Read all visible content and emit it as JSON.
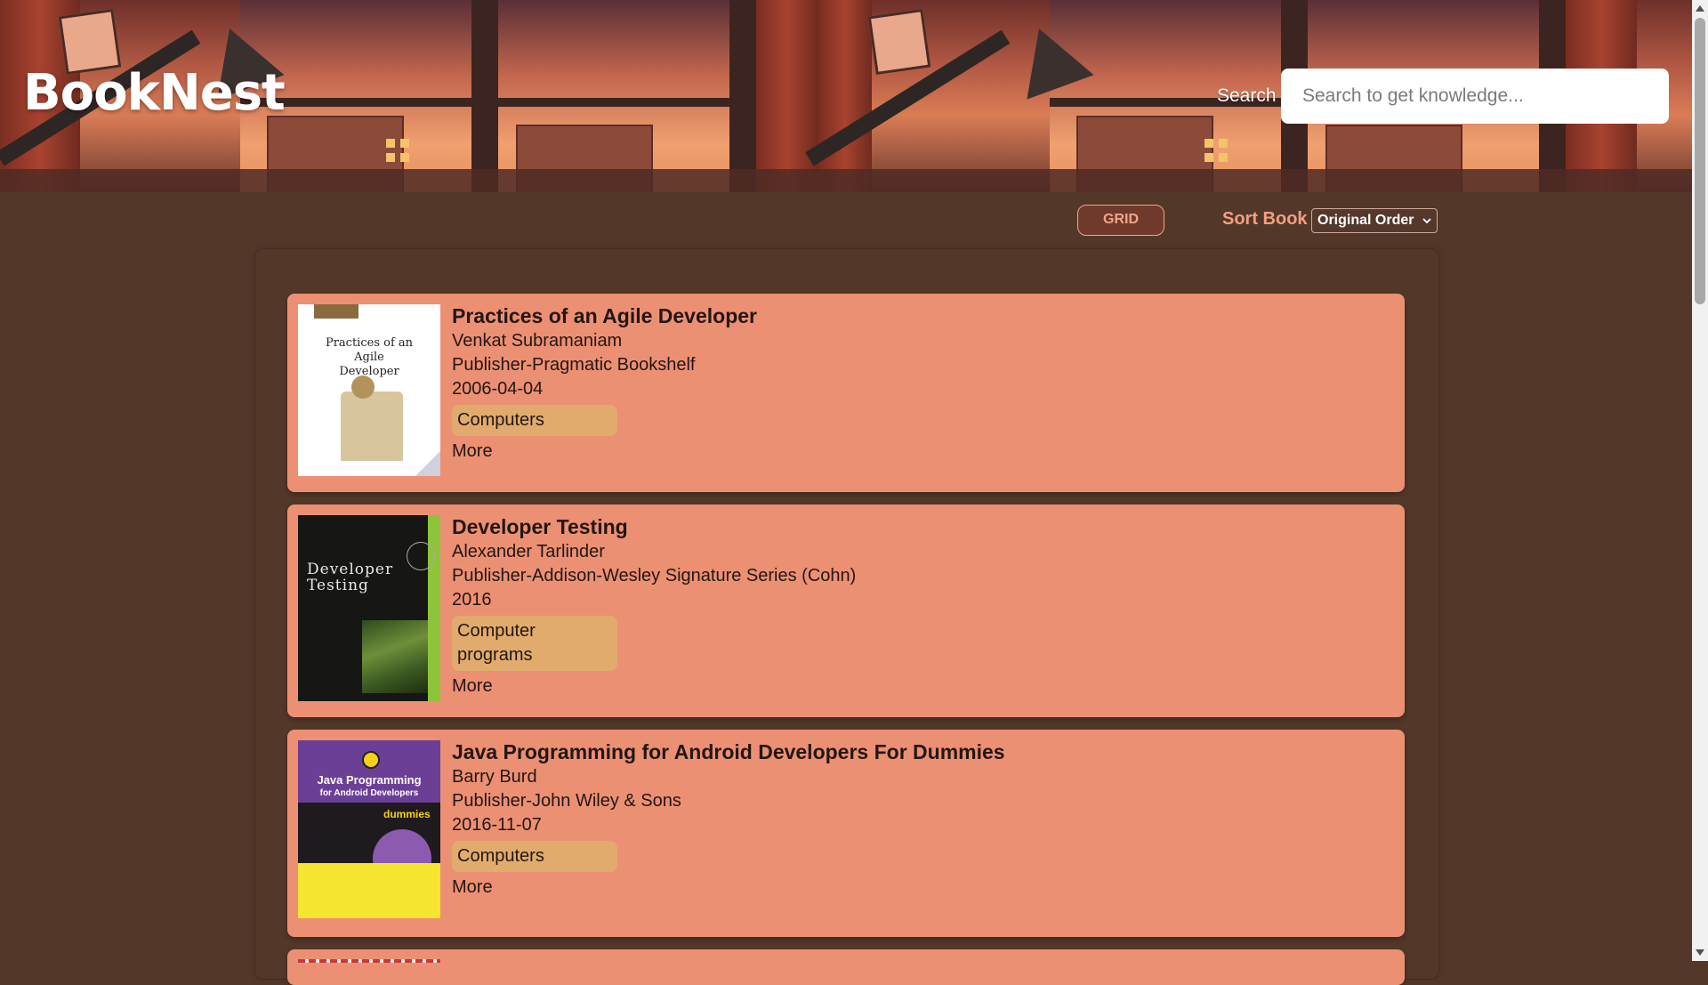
{
  "app": {
    "logo": "BookNest"
  },
  "search": {
    "label": "Search",
    "placeholder": "Search to get knowledge...",
    "value": ""
  },
  "toolbar": {
    "view_toggle_label": "GRID",
    "sort_label": "Sort Book",
    "sort_selected": "Original Order"
  },
  "books": [
    {
      "title": "Practices of an Agile Developer",
      "author": "Venkat Subramaniam",
      "publisher": "Publisher-Pragmatic Bookshelf",
      "date": "2006-04-04",
      "category": "Computers",
      "more_label": "More",
      "cover_text": [
        "Practices of an",
        "Agile",
        "Developer"
      ]
    },
    {
      "title": "Developer Testing",
      "author": "Alexander Tarlinder",
      "publisher": "Publisher-Addison-Wesley Signature Series (Cohn)",
      "date": "2016",
      "category": "Computer programs",
      "more_label": "More",
      "cover_text": [
        "Developer",
        "Testing"
      ]
    },
    {
      "title": "Java Programming for Android Developers For Dummies",
      "author": "Barry Burd",
      "publisher": "Publisher-John Wiley & Sons",
      "date": "2016-11-07",
      "category": "Computers",
      "more_label": "More",
      "cover_text": [
        "Java Programming",
        "for Android Developers",
        "dummies"
      ]
    }
  ],
  "colors": {
    "page_background": "#533729",
    "card_background": "#ec9074",
    "tag_background": "#e1ab6d",
    "accent": "#f2a07f"
  },
  "icons": {
    "sort_dropdown": "chevron-down-icon",
    "scroll_up": "arrow-up-icon",
    "scroll_down": "arrow-down-icon"
  }
}
